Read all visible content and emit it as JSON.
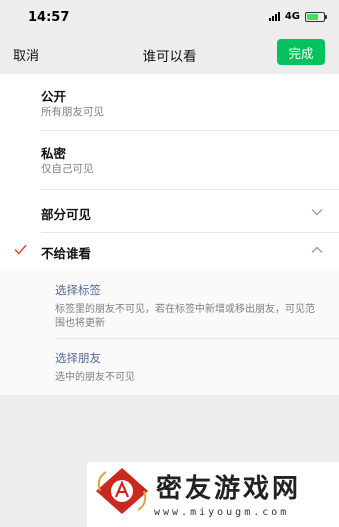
{
  "status_bar": {
    "time": "14:57",
    "network": "4G"
  },
  "nav": {
    "cancel_label": "取消",
    "title": "谁可以看",
    "done_label": "完成"
  },
  "options": [
    {
      "title": "公开",
      "subtitle": "所有朋友可见",
      "selected": false
    },
    {
      "title": "私密",
      "subtitle": "仅自己可见",
      "selected": false
    },
    {
      "title": "部分可见",
      "expanded": false,
      "selected": false
    },
    {
      "title": "不给谁看",
      "expanded": true,
      "selected": true
    }
  ],
  "exclude_panel": {
    "tags_link": "选择标签",
    "tags_desc": "标签里的朋友不可见，若在标签中新增或移出朋友，可见范围也将更新",
    "friends_link": "选择朋友",
    "friends_desc": "选中的朋友不可见"
  },
  "watermark": {
    "title": "密友游戏网",
    "url": "www.miyougm.com"
  },
  "colors": {
    "accent_green": "#07c160",
    "link_blue": "#576b95",
    "check_red": "#e64340"
  }
}
